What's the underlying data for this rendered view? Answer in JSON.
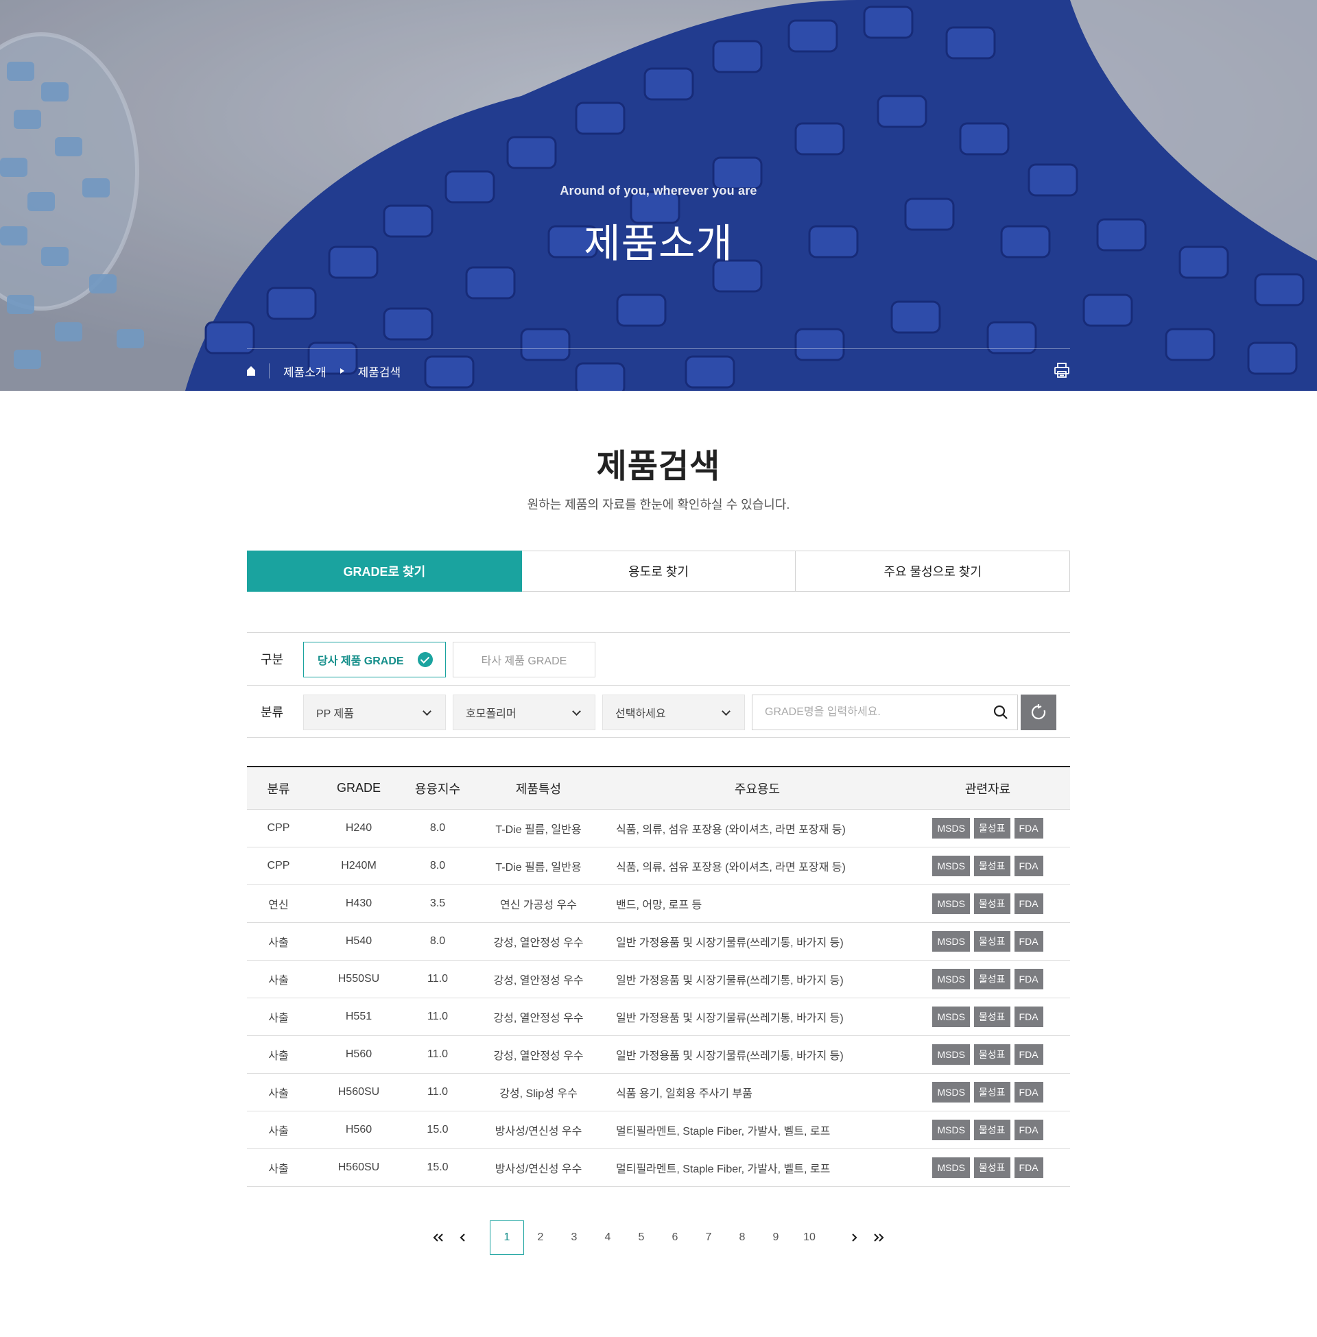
{
  "hero": {
    "subtitle": "Around of you, wherever you are",
    "title": "제품소개"
  },
  "breadcrumb": {
    "home_icon": "home-icon",
    "items": [
      "제품소개",
      "제품검색"
    ],
    "print_icon": "printer-icon"
  },
  "page": {
    "title": "제품검색",
    "description": "원하는 제품의 자료를 한눈에 확인하실 수 있습니다."
  },
  "tabs": [
    {
      "label": "GRADE로 찾기",
      "active": true
    },
    {
      "label": "용도로 찾기",
      "active": false
    },
    {
      "label": "주요 물성으로 찾기",
      "active": false
    }
  ],
  "filter": {
    "gubun_label": "구분",
    "grade_own": "당사 제품 GRADE",
    "grade_other": "타사 제품 GRADE",
    "bunryu_label": "분류",
    "select1": "PP 제품",
    "select2": "호모폴리머",
    "select3": "선택하세요",
    "search_placeholder": "GRADE명을 입력하세요.",
    "search_value": ""
  },
  "colors": {
    "accent": "#1aa39f",
    "badge": "#7b7c80",
    "button_dark": "#76777b"
  },
  "table": {
    "headers": [
      "분류",
      "GRADE",
      "용융지수",
      "제품특성",
      "주요용도",
      "관련자료"
    ],
    "docs": [
      "MSDS",
      "물성표",
      "FDA"
    ],
    "rows": [
      [
        "CPP",
        "H240",
        "8.0",
        "T-Die 필름, 일반용",
        "식품, 의류, 섬유 포장용 (와이셔츠, 라면 포장재 등)"
      ],
      [
        "CPP",
        "H240M",
        "8.0",
        "T-Die 필름, 일반용",
        "식품, 의류, 섬유 포장용 (와이셔츠, 라면 포장재 등)"
      ],
      [
        "연신",
        "H430",
        "3.5",
        "연신 가공성 우수",
        "밴드, 어망, 로프 등"
      ],
      [
        "사출",
        "H540",
        "8.0",
        "강성, 열안정성 우수",
        "일반 가정용품 및 시장기물류(쓰레기통, 바가지 등)"
      ],
      [
        "사출",
        "H550SU",
        "11.0",
        "강성, 열안정성 우수",
        "일반 가정용품 및 시장기물류(쓰레기통, 바가지 등)"
      ],
      [
        "사출",
        "H551",
        "11.0",
        "강성, 열안정성 우수",
        "일반 가정용품 및 시장기물류(쓰레기통, 바가지 등)"
      ],
      [
        "사출",
        "H560",
        "11.0",
        "강성, 열안정성 우수",
        "일반 가정용품 및 시장기물류(쓰레기통, 바가지 등)"
      ],
      [
        "사출",
        "H560SU",
        "11.0",
        "강성, Slip성 우수",
        "식품 용기, 일회용 주사기 부품"
      ],
      [
        "사출",
        "H560",
        "15.0",
        "방사성/연신성 우수",
        "멀티필라멘트, Staple Fiber, 가발사, 벨트, 로프"
      ],
      [
        "사출",
        "H560SU",
        "15.0",
        "방사성/연신성 우수",
        "멀티필라멘트, Staple Fiber, 가발사, 벨트, 로프"
      ]
    ]
  },
  "pagination": {
    "current": "1",
    "pages": [
      "1",
      "2",
      "3",
      "4",
      "5",
      "6",
      "7",
      "8",
      "9",
      "10"
    ]
  }
}
